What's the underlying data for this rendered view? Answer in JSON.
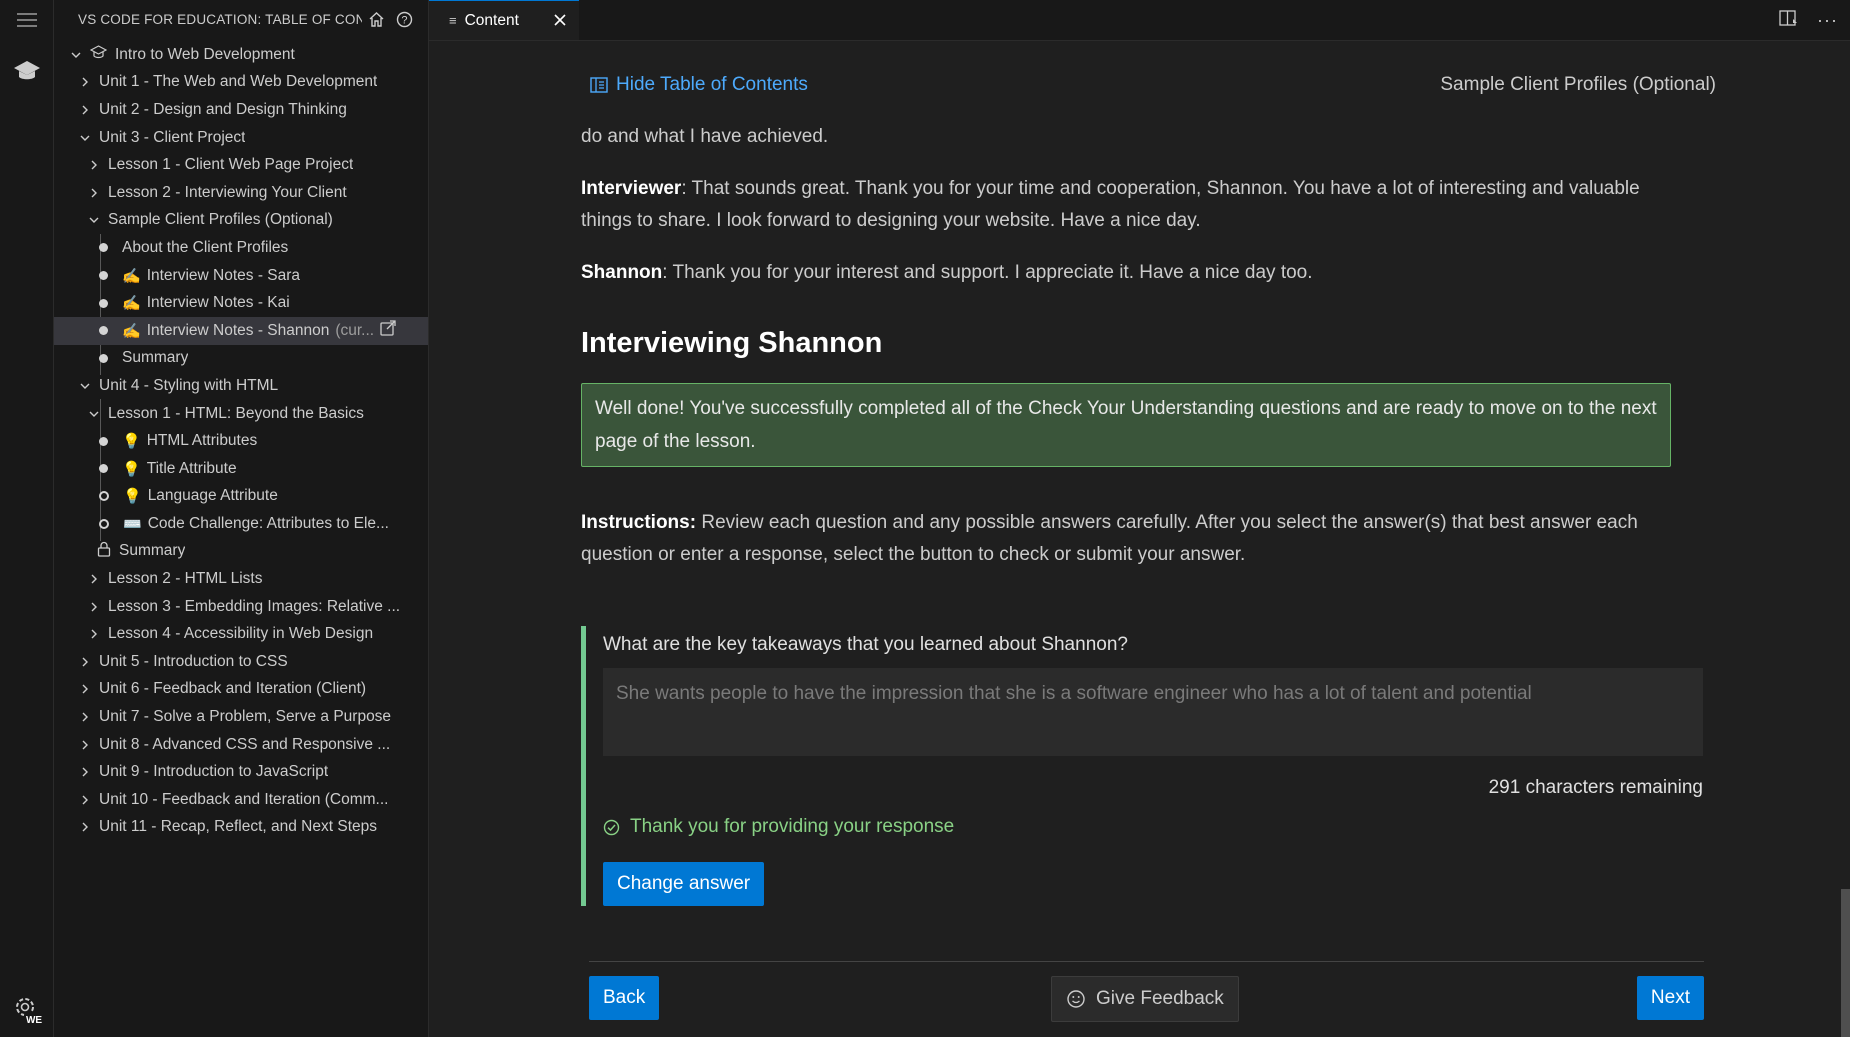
{
  "activity": {
    "badge": "WE"
  },
  "sidebar": {
    "title": "VS CODE FOR EDUCATION: TABLE OF CON...",
    "tree": [
      {
        "label": "Intro to Web Development",
        "type": "course"
      },
      {
        "label": "Unit 1 - The Web and Web Development",
        "type": "collapsed"
      },
      {
        "label": "Unit 2 - Design and Design Thinking",
        "type": "collapsed"
      },
      {
        "label": "Unit 3 - Client Project",
        "type": "expanded"
      },
      {
        "label": "Lesson 1 - Client Web Page Project",
        "type": "collapsed"
      },
      {
        "label": "Lesson 2 - Interviewing Your Client",
        "type": "collapsed"
      },
      {
        "label": "Sample Client Profiles (Optional)",
        "type": "expanded"
      },
      {
        "label": "About the Client Profiles",
        "type": "page"
      },
      {
        "label": "Interview Notes - Sara",
        "type": "page",
        "emoji": "✍️"
      },
      {
        "label": "Interview Notes - Kai",
        "type": "page",
        "emoji": "✍️"
      },
      {
        "label": "Interview Notes - Shannon",
        "type": "page",
        "emoji": "✍️",
        "current": "(cur..."
      },
      {
        "label": "Summary",
        "type": "page"
      },
      {
        "label": "Unit 4 - Styling with HTML",
        "type": "expanded"
      },
      {
        "label": "Lesson 1 - HTML: Beyond the Basics",
        "type": "expanded"
      },
      {
        "label": "HTML Attributes",
        "type": "page",
        "emoji": "💡"
      },
      {
        "label": "Title Attribute",
        "type": "page",
        "emoji": "💡"
      },
      {
        "label": "Language Attribute",
        "type": "page-open",
        "emoji": "💡"
      },
      {
        "label": "Code Challenge: Attributes to Ele...",
        "type": "page-open",
        "emoji": "⌨️"
      },
      {
        "label": "Summary",
        "type": "locked"
      },
      {
        "label": "Lesson 2 - HTML Lists",
        "type": "collapsed"
      },
      {
        "label": "Lesson 3 - Embedding Images: Relative ...",
        "type": "collapsed"
      },
      {
        "label": "Lesson 4 - Accessibility in Web Design",
        "type": "collapsed"
      },
      {
        "label": "Unit 5 - Introduction to CSS",
        "type": "collapsed"
      },
      {
        "label": "Unit 6 - Feedback and Iteration (Client)",
        "type": "collapsed"
      },
      {
        "label": "Unit 7 - Solve a Problem, Serve a Purpose",
        "type": "collapsed"
      },
      {
        "label": "Unit 8 - Advanced CSS and Responsive ...",
        "type": "collapsed"
      },
      {
        "label": "Unit 9 - Introduction to JavaScript",
        "type": "collapsed"
      },
      {
        "label": "Unit 10 - Feedback and Iteration (Comm...",
        "type": "collapsed"
      },
      {
        "label": "Unit 11 - Recap, Reflect, and Next Steps",
        "type": "collapsed"
      }
    ]
  },
  "editor": {
    "tab_label": "Content",
    "toc_toggle": "Hide Table of Contents",
    "page_label": "Sample Client Profiles (Optional)",
    "para_1": "do and what I have achieved.",
    "para_2_speaker": "Interviewer",
    "para_2_text": ": That sounds great. Thank you for your time and cooperation, Shannon. You have a lot of interesting and valuable things to share. I look forward to designing your website. Have a nice day.",
    "para_3_speaker": "Shannon",
    "para_3_text": ": Thank you for your interest and support. I appreciate it. Have a nice day too.",
    "heading": "Interviewing Shannon",
    "success_msg": "Well done! You've successfully completed all of the Check Your Understanding questions and are ready to move on to the next page of the lesson.",
    "instructions_label": "Instructions:",
    "instructions_text": " Review each question and any possible answers carefully. After you select the answer(s) that best answer each question or enter a response, select the button to check or submit your answer.",
    "question": "What are the key takeaways that you learned about Shannon?",
    "answer": "She wants people to have the impression that she is a software engineer who has a lot of talent and potential",
    "remaining": "291 characters remaining",
    "thanks": "Thank you for providing your response",
    "change_btn": "Change answer",
    "back_btn": "Back",
    "feedback_btn": "Give Feedback",
    "next_btn": "Next"
  },
  "colors": {
    "accent": "#0078d4",
    "link": "#4daafc",
    "success": "#89d185",
    "success_bg": "#3a553a"
  }
}
